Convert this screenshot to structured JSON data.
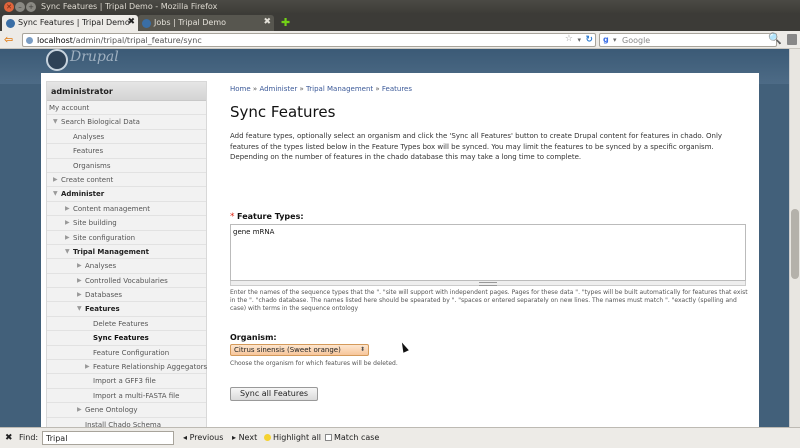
{
  "window": {
    "title": "Sync Features | Tripal Demo - Mozilla Firefox",
    "close_glyph": "✕",
    "min_glyph": "–",
    "max_glyph": "+"
  },
  "tabs": [
    {
      "label": "Sync Features | Tripal Demo",
      "active": true
    },
    {
      "label": "Jobs | Tripal Demo",
      "active": false
    }
  ],
  "tab_close_glyph": "✖",
  "new_tab_glyph": "✚",
  "nav": {
    "back_glyph": "⇦",
    "url_host": "localhost",
    "url_path": "/admin/tripal/tripal_feature/sync",
    "star_glyph": "☆",
    "dropdown_glyph": "▾",
    "reload_glyph": "↻",
    "search_engine_glyph": "g",
    "search_placeholder": "Google",
    "search_icon_glyph": "🔍"
  },
  "site": {
    "logo_text": "Drupal"
  },
  "sidebar": {
    "heading": "administrator",
    "items": [
      {
        "label": "My account",
        "indent": 0,
        "arrow": ""
      },
      {
        "label": "Search Biological Data",
        "indent": 1,
        "arrow": "▼"
      },
      {
        "label": "Analyses",
        "indent": 2,
        "arrow": ""
      },
      {
        "label": "Features",
        "indent": 2,
        "arrow": ""
      },
      {
        "label": "Organisms",
        "indent": 2,
        "arrow": ""
      },
      {
        "label": "Create content",
        "indent": 1,
        "arrow": "▶"
      },
      {
        "label": "Administer",
        "indent": 1,
        "arrow": "▼",
        "bold": true
      },
      {
        "label": "Content management",
        "indent": 2,
        "arrow": "▶"
      },
      {
        "label": "Site building",
        "indent": 2,
        "arrow": "▶"
      },
      {
        "label": "Site configuration",
        "indent": 2,
        "arrow": "▶"
      },
      {
        "label": "Tripal Management",
        "indent": 2,
        "arrow": "▼",
        "bold": true
      },
      {
        "label": "Analyses",
        "indent": 3,
        "arrow": "▶"
      },
      {
        "label": "Controlled Vocabularies",
        "indent": 3,
        "arrow": "▶"
      },
      {
        "label": "Databases",
        "indent": 3,
        "arrow": "▶"
      },
      {
        "label": "Features",
        "indent": 3,
        "arrow": "▼",
        "bold": true
      },
      {
        "label": "Delete Features",
        "indent": 4,
        "arrow": ""
      },
      {
        "label": "Sync Features",
        "indent": 4,
        "arrow": "",
        "selected": true
      },
      {
        "label": "Feature Configuration",
        "indent": 4,
        "arrow": ""
      },
      {
        "label": "Feature Relationship Aggegators",
        "indent": 4,
        "arrow": "▶"
      },
      {
        "label": "Import a GFF3 file",
        "indent": 4,
        "arrow": ""
      },
      {
        "label": "Import a multi-FASTA file",
        "indent": 4,
        "arrow": ""
      },
      {
        "label": "Gene Ontology",
        "indent": 3,
        "arrow": "▶"
      },
      {
        "label": "Install Chado Schema",
        "indent": 3,
        "arrow": ""
      }
    ]
  },
  "breadcrumb": {
    "items": [
      "Home",
      "Administer",
      "Tripal Management",
      "Features"
    ],
    "separator": "»"
  },
  "main": {
    "title": "Sync Features",
    "description": "Add feature types, optionally select an organism and click the 'Sync all Features' button to create Drupal content for features in chado. Only features of the types listed below in the Feature Types box will be synced. You may limit the features to be synced by a specific organism. Depending on the number of features in the chado database this may take a long time to complete.",
    "feature_types_label": "Feature Types:",
    "required_mark": "*",
    "feature_types_value": "gene mRNA",
    "feature_types_help": "Enter the names of the sequence types that the \". \"site will support with independent pages. Pages for these data \". \"types will be built automatically for features that exist in the \". \"chado database. The names listed here should be spearated by \". \"spaces or entered separately on new lines. The names must match \". \"exactly (spelling and case) with terms in the sequence ontology",
    "organism_label": "Organism:",
    "organism_selected": "Citrus sinensis (Sweet orange)",
    "organism_help": "Choose the organism for which features will be deleted.",
    "submit_label": "Sync all Features",
    "select_caret": "⬍"
  },
  "findbar": {
    "close_glyph": "✖",
    "label": "Find:",
    "value": "Tripal",
    "prev_label": "Previous",
    "next_label": "Next",
    "highlight_label": "Highlight all",
    "match_case_label": "Match case",
    "prev_glyph": "◂",
    "next_glyph": "▸"
  }
}
